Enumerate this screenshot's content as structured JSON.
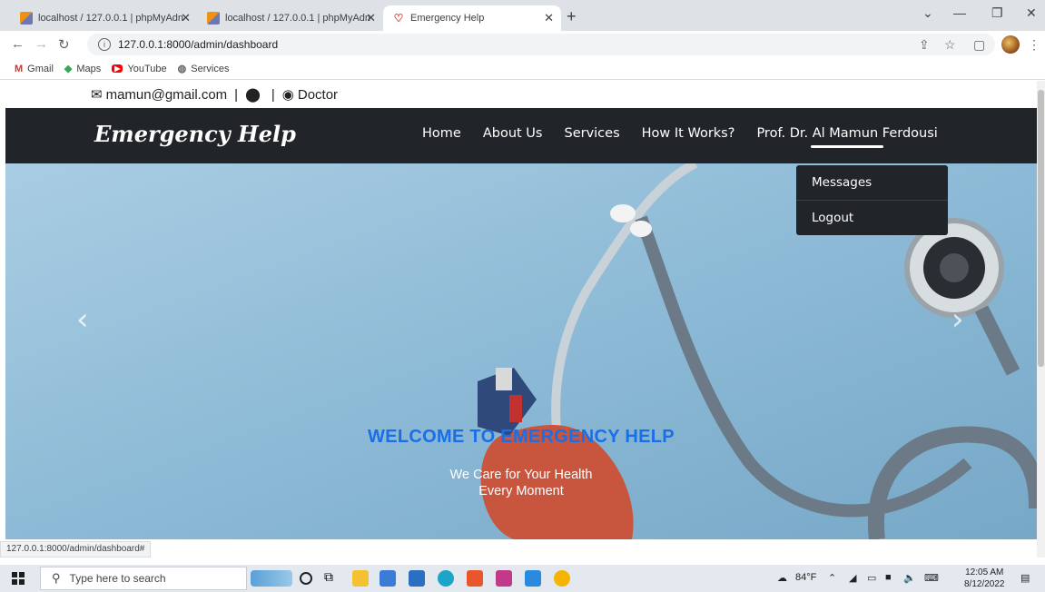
{
  "browser": {
    "tabs": [
      {
        "title": "localhost / 127.0.0.1 | phpMyAdn",
        "favicon": "phpmyadmin-icon"
      },
      {
        "title": "localhost / 127.0.0.1 | phpMyAdn",
        "favicon": "phpmyadmin-icon"
      },
      {
        "title": "Emergency Help",
        "favicon": "emergency-help-icon",
        "active": true
      }
    ],
    "url": "127.0.0.1:8000/admin/dashboard",
    "bookmarks": [
      {
        "label": "Gmail",
        "icon": "gmail-icon"
      },
      {
        "label": "Maps",
        "icon": "maps-icon"
      },
      {
        "label": "YouTube",
        "icon": "youtube-icon"
      },
      {
        "label": "Services",
        "icon": "globe-icon"
      }
    ],
    "status_url": "127.0.0.1:8000/admin/dashboard#"
  },
  "topbar": {
    "email": "mamun@gmail.com",
    "separator": "|",
    "role": "Doctor"
  },
  "navbar": {
    "brand": "Emergency Help",
    "links": [
      "Home",
      "About Us",
      "Services",
      "How It Works?"
    ],
    "user": "Prof. Dr. Al Mamun Ferdousi"
  },
  "dropdown": {
    "items": [
      "Messages",
      "Logout"
    ]
  },
  "hero": {
    "title": "WELCOME TO EMERGENCY HELP",
    "subtitle_line1": "We Care for Your Health",
    "subtitle_line2": "Every Moment"
  },
  "taskbar": {
    "search_placeholder": "Type here to search",
    "weather": "84°F",
    "time": "12:05 AM",
    "date": "8/12/2022"
  },
  "colors": {
    "navbar_bg": "#212529",
    "hero_title": "#1a6fe8",
    "hero_bg": "#8ab8d5"
  }
}
